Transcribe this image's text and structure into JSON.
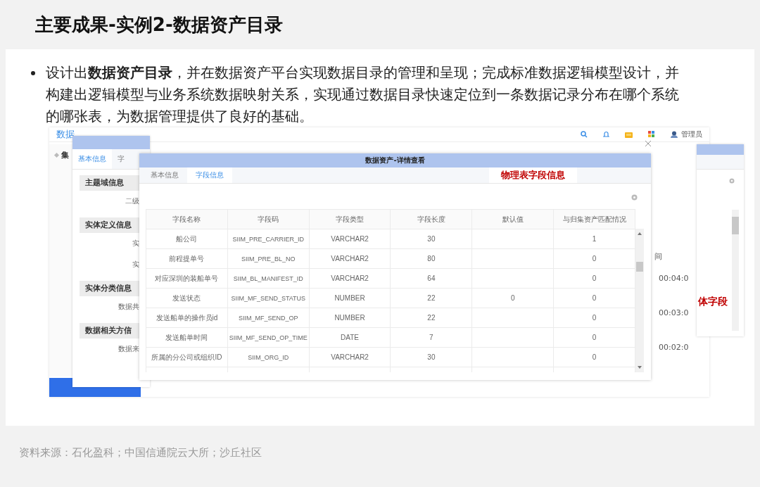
{
  "slide": {
    "title": "主要成果-实例2-数据资产目录",
    "bullet": "设计出**数据资产目录**，并在数据资产平台实现数据目录的管理和呈现；完成标准数据逻辑模型设计，并构建出逻辑模型与业务系统数据映射关系，实现通过数据目录快速定位到一条数据记录分布在哪个系统的哪张表，为数据管理提供了良好的基础。",
    "source": "资料来源：石化盈科；中国信通院云大所；沙丘社区"
  },
  "screenshot": {
    "app": {
      "header_title": "数据",
      "user": "管理员",
      "sidebar_item": "集",
      "column_header": "间",
      "times": [
        "00:04:0",
        "00:03:0",
        "00:02:0"
      ]
    },
    "basic_info_window": {
      "tabs": [
        {
          "label": "基本信息",
          "selected": true
        },
        {
          "label": "字",
          "selected": false
        }
      ],
      "items": [
        {
          "kind": "section",
          "text": "主题域信息"
        },
        {
          "kind": "field",
          "text": "二级"
        },
        {
          "kind": "section",
          "text": "实体定义信息"
        },
        {
          "kind": "field",
          "text": "实"
        },
        {
          "kind": "field",
          "text": "实"
        },
        {
          "kind": "section",
          "text": "实体分类信息"
        },
        {
          "kind": "field",
          "text": "数据共"
        },
        {
          "kind": "section",
          "text": "数据相关方信"
        },
        {
          "kind": "field",
          "text": "数据来"
        }
      ]
    },
    "detail_window": {
      "title": "数据资产-详情查看",
      "tabs": [
        {
          "label": "基本信息",
          "selected": false
        },
        {
          "label": "字段信息",
          "selected": true
        }
      ],
      "annotation": "物理表字段信息",
      "table": {
        "columns": [
          "字段名称",
          "字段码",
          "字段类型",
          "字段长度",
          "默认值",
          "与归集资产匹配情况"
        ],
        "rows": [
          {
            "name": "船公司",
            "code": "SIIM_PRE_CARRIER_ID",
            "type": "VARCHAR2",
            "length": "30",
            "match": "1"
          },
          {
            "name": "前程提单号",
            "code": "SIIM_PRE_BL_NO",
            "type": "VARCHAR2",
            "length": "80",
            "match": "0"
          },
          {
            "name": "对应深圳的装船单号",
            "code": "SIIM_BL_MANIFEST_ID",
            "type": "VARCHAR2",
            "length": "64",
            "match": "0"
          },
          {
            "name": "发送状态",
            "code": "SIIM_MF_SEND_STATUS",
            "type": "NUMBER",
            "length": "22",
            "default": "0",
            "match": "0"
          },
          {
            "name": "发送船单的操作员id",
            "code": "SIIM_MF_SEND_OP",
            "type": "NUMBER",
            "length": "22",
            "match": "0"
          },
          {
            "name": "发送船单时间",
            "code": "SIIM_MF_SEND_OP_TIME",
            "type": "DATE",
            "length": "7",
            "match": "0"
          },
          {
            "name": "所属的分公司或组织ID",
            "code": "SIIM_ORG_ID",
            "type": "VARCHAR2",
            "length": "30",
            "match": "0"
          }
        ]
      }
    },
    "side_window": {
      "annotation": "体字段"
    }
  }
}
